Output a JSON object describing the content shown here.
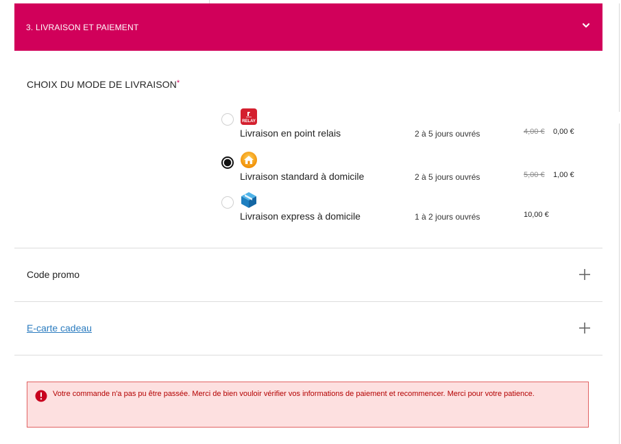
{
  "checkout": {
    "section_title": "3. LIVRAISON ET PAIEMENT",
    "shipping_label": "CHOIX DU MODE DE LIVRAISON",
    "required_marker": "*",
    "shipping_options": [
      {
        "name": "Livraison en point relais",
        "delay": "2 à 5 jours ouvrés",
        "old_price": "4,00 €",
        "price": "0,00 €",
        "selected": false,
        "logo_icon": "mondial-relay-icon",
        "logo_text": "RELAY"
      },
      {
        "name": "Livraison standard à domicile",
        "delay": "2 à 5 jours ouvrés",
        "old_price": "5,00 €",
        "price": "1,00 €",
        "selected": true,
        "logo_icon": "home-icon"
      },
      {
        "name": "Livraison express à domicile",
        "delay": "1 à 2 jours ouvrés",
        "old_price": "",
        "price": "10,00 €",
        "selected": false,
        "logo_icon": "package-box-icon"
      }
    ],
    "promo_label": "Code promo",
    "gift_card_label": "E-carte cadeau",
    "error_message": "Votre commande n'a pas pu être passée. Merci de bien vouloir vérifier vos informations de paiement et recommencer. Merci pour votre patience."
  },
  "colors": {
    "brand": "#d1005a",
    "error_bg": "#fde0e0",
    "error_text": "#b30000",
    "link": "#2a7bbf"
  }
}
